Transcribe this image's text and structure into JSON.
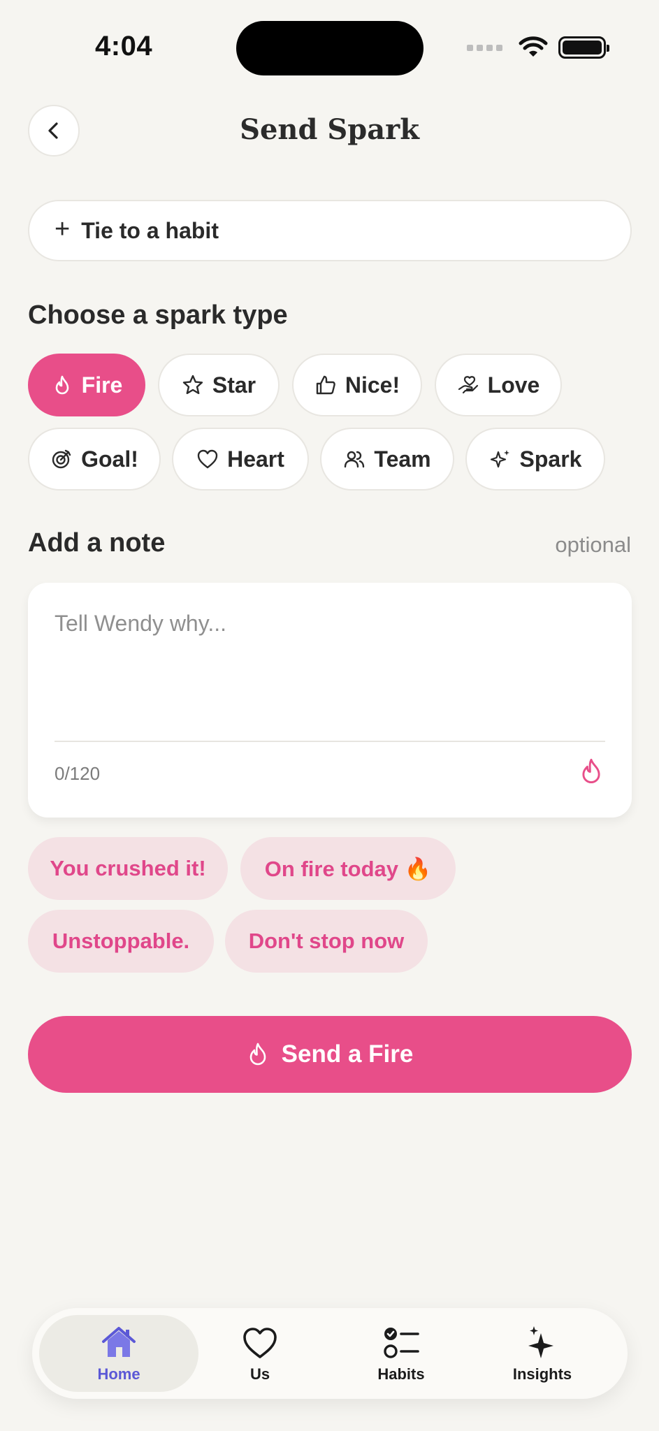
{
  "status_bar": {
    "time": "4:04"
  },
  "header": {
    "title": "Send Spark"
  },
  "tie_habit": {
    "label": "Tie to a habit"
  },
  "spark_section": {
    "title": "Choose a spark type",
    "types": [
      {
        "label": "Fire",
        "icon": "flame-icon",
        "selected": true
      },
      {
        "label": "Star",
        "icon": "star-icon"
      },
      {
        "label": "Nice!",
        "icon": "thumbs-up-icon"
      },
      {
        "label": "Love",
        "icon": "hand-heart-icon"
      },
      {
        "label": "Goal!",
        "icon": "target-icon"
      },
      {
        "label": "Heart",
        "icon": "heart-icon"
      },
      {
        "label": "Team",
        "icon": "users-icon"
      },
      {
        "label": "Spark",
        "icon": "sparkles-icon"
      }
    ]
  },
  "note": {
    "title": "Add a note",
    "optional_label": "optional",
    "placeholder": "Tell Wendy why...",
    "value": "",
    "counter": "0/120"
  },
  "suggestions": [
    "You crushed it!",
    "On fire today 🔥",
    "Unstoppable.",
    "Don't stop now"
  ],
  "send_button": {
    "label": "Send a Fire"
  },
  "tabbar": {
    "tabs": [
      {
        "label": "Home",
        "icon": "home-icon",
        "active": true
      },
      {
        "label": "Us",
        "icon": "heart-icon"
      },
      {
        "label": "Habits",
        "icon": "checklist-icon"
      },
      {
        "label": "Insights",
        "icon": "sparkles-icon"
      }
    ]
  },
  "colors": {
    "accent": "#e84e89",
    "background": "#f6f5f1",
    "suggestion_bg": "#f4e1e4",
    "tab_active": "#5b58d6"
  }
}
